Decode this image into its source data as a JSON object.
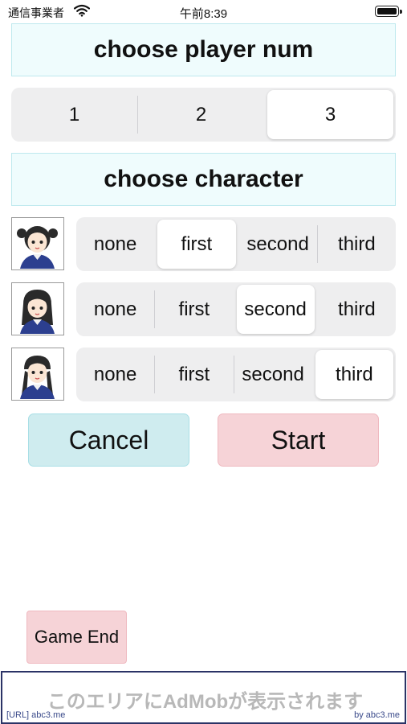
{
  "status_bar": {
    "carrier": "通信事業者",
    "time": "午前8:39"
  },
  "player_section": {
    "title": "choose player num",
    "options": [
      "1",
      "2",
      "3"
    ],
    "selected": "3"
  },
  "character_section": {
    "title": "choose character",
    "option_labels": [
      "none",
      "first",
      "second",
      "third"
    ],
    "rows": [
      {
        "selected": "first"
      },
      {
        "selected": "second"
      },
      {
        "selected": "third"
      }
    ]
  },
  "actions": {
    "cancel_label": "Cancel",
    "start_label": "Start",
    "game_end_label": "Game End"
  },
  "ad_banner": {
    "text": "このエリアにAdMobが表示されます",
    "url_text": "[URL] abc3.me",
    "by_text": "by abc3.me"
  },
  "colors": {
    "title_bg": "#effcfd",
    "cancel_bg": "#cfecef",
    "start_bg": "#f6d3d7",
    "segment_bg": "#eeeeef"
  }
}
